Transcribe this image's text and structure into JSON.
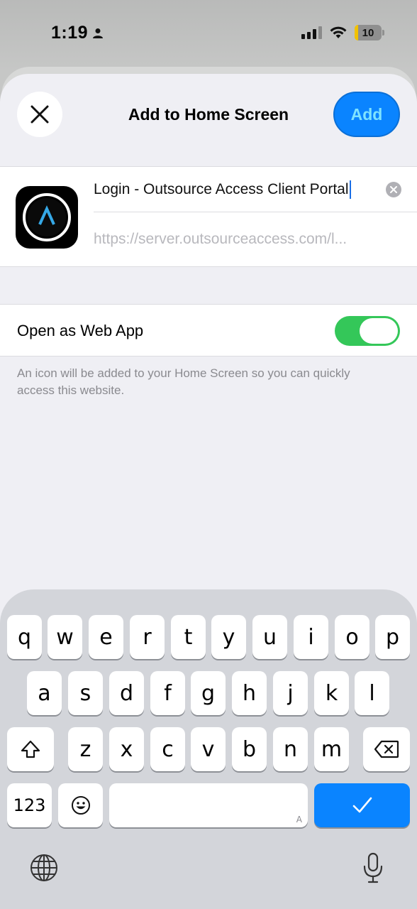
{
  "status": {
    "time": "1:19",
    "battery": "10"
  },
  "header": {
    "title": "Add to Home Screen",
    "add_label": "Add"
  },
  "bookmark": {
    "name": "Login - Outsource Access Client Portal",
    "url": "https://server.outsourceaccess.com/l..."
  },
  "web_app": {
    "label": "Open as Web App",
    "enabled": true
  },
  "footnote": "An icon will be added to your Home Screen so you can quickly access this website.",
  "keyboard": {
    "row1": [
      "q",
      "w",
      "e",
      "r",
      "t",
      "y",
      "u",
      "i",
      "o",
      "p"
    ],
    "row2": [
      "a",
      "s",
      "d",
      "f",
      "g",
      "h",
      "j",
      "k",
      "l"
    ],
    "row3": [
      "z",
      "x",
      "c",
      "v",
      "b",
      "n",
      "m"
    ],
    "numbers_label": "123",
    "space_hint": "A"
  },
  "colors": {
    "accent": "#0a84ff",
    "toggle_on": "#34c759",
    "icon_ring": "#35a8e6"
  }
}
